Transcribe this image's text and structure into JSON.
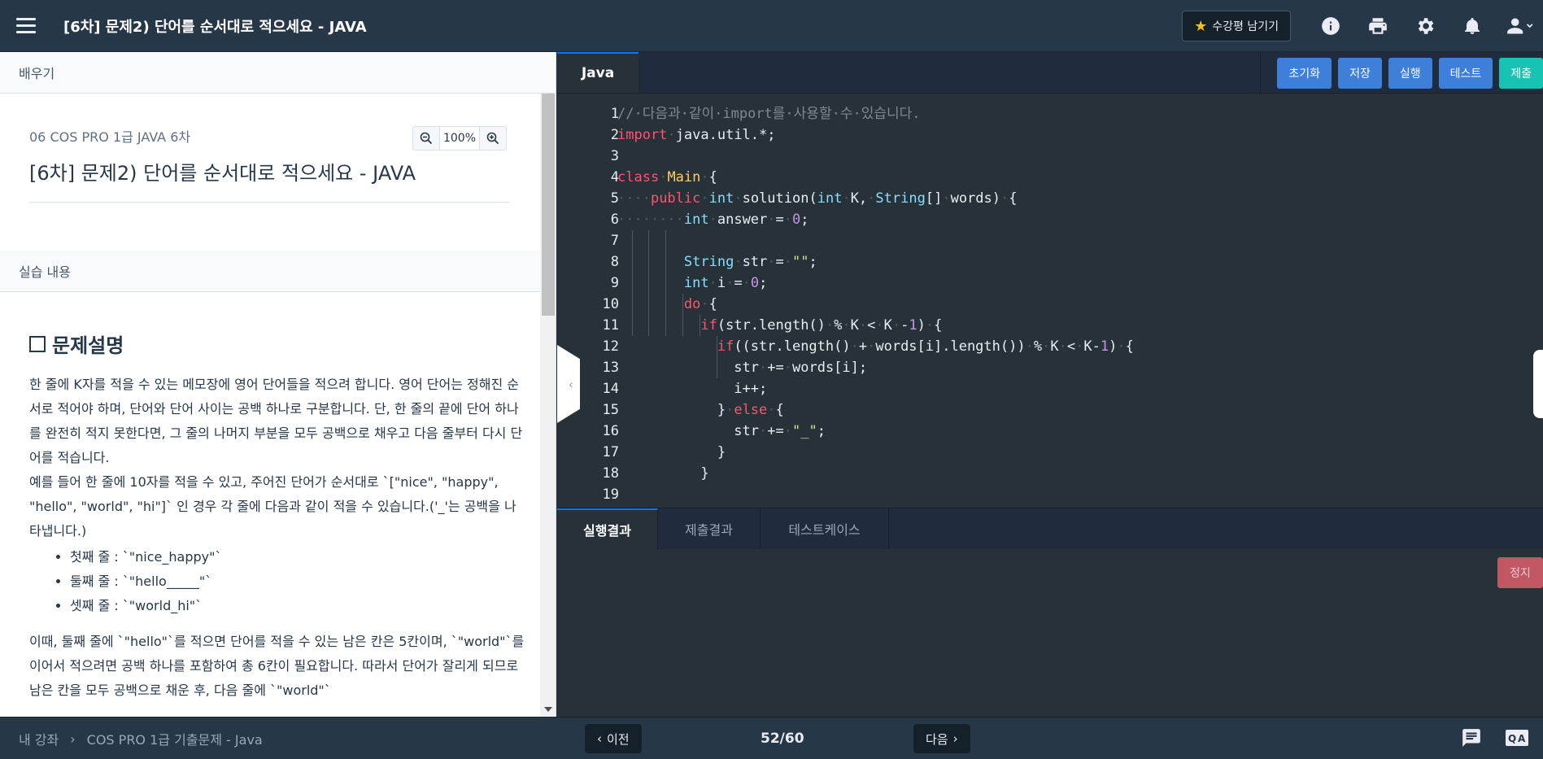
{
  "header": {
    "title": "[6차] 문제2) 단어를 순서대로 적으세요 - JAVA",
    "review_label": "수강평 남기기",
    "icons": [
      "info-icon",
      "print-icon",
      "gear-icon",
      "bell-icon",
      "user-icon"
    ]
  },
  "left": {
    "learn_label": "배우기",
    "course_sub": "06 COS PRO 1급 JAVA 6차",
    "lesson_title": "[6차] 문제2) 단어를 순서대로 적으세요 - JAVA",
    "zoom_level": "100%",
    "practice_label": "실습 내용",
    "problem_heading": "문제설명",
    "paragraph1": "한 줄에 K자를 적을 수 있는 메모장에 영어 단어들을 적으려 합니다. 영어 단어는 정해진 순서로 적어야 하며, 단어와 단어 사이는 공백 하나로 구분합니다. 단, 한 줄의 끝에 단어 하나를 완전히 적지 못한다면, 그 줄의 나머지 부분을 모두 공백으로 채우고 다음 줄부터 다시 단어를 적습니다.",
    "paragraph2": "예를 들어 한 줄에 10자를 적을 수 있고, 주어진 단어가 순서대로 `[\"nice\", \"happy\", \"hello\", \"world\", \"hi\"]` 인 경우 각 줄에 다음과 같이 적을 수 있습니다.('_'는 공백을 나타냅니다.)",
    "bullets": [
      "첫째 줄 : `\"nice_happy\"`",
      "둘째 줄 : `\"hello_____\"`",
      "셋째 줄 : `\"world_hi\"`"
    ],
    "paragraph3": "이때, 둘째 줄에 `\"hello\"`를 적으면 단어를 적을 수 있는 남은 칸은 5칸이며, `\"world\"`를 이어서 적으려면 공백 하나를 포함하여 총 6칸이 필요합니다. 따라서 단어가 잘리게 되므로 남은 칸을 모두 공백으로 채운 후, 다음 줄에 `\"world\"`"
  },
  "editor": {
    "language_tab": "Java",
    "actions": [
      "초기화",
      "저장",
      "실행",
      "테스트",
      "제출"
    ],
    "lines": [
      {
        "n": "1",
        "tokens": [
          [
            "cm",
            "//·다음과·같이·import를·사용할·수·있습니다."
          ]
        ]
      },
      {
        "n": "2",
        "tokens": [
          [
            "kw",
            "import"
          ],
          [
            "dim",
            "·"
          ],
          [
            "",
            "java.util.*;"
          ]
        ]
      },
      {
        "n": "3",
        "tokens": []
      },
      {
        "n": "4",
        "tokens": [
          [
            "kw",
            "class"
          ],
          [
            "dim",
            "·"
          ],
          [
            "cl",
            "Main"
          ],
          [
            "dim",
            "·"
          ],
          [
            "",
            "{"
          ]
        ]
      },
      {
        "n": "5",
        "tokens": [
          [
            "dim",
            "····"
          ],
          [
            "kw",
            "public"
          ],
          [
            "dim",
            "·"
          ],
          [
            "ty",
            "int"
          ],
          [
            "dim",
            "·"
          ],
          [
            "",
            "solution("
          ],
          [
            "ty",
            "int"
          ],
          [
            "dim",
            "·"
          ],
          [
            "",
            "K,"
          ],
          [
            "dim",
            "·"
          ],
          [
            "ty",
            "String"
          ],
          [
            "",
            "[]"
          ],
          [
            "dim",
            "·"
          ],
          [
            "",
            "words)"
          ],
          [
            "dim",
            "·"
          ],
          [
            "",
            "{"
          ]
        ]
      },
      {
        "n": "6",
        "tokens": [
          [
            "dim",
            "········"
          ],
          [
            "ty",
            "int"
          ],
          [
            "dim",
            "·"
          ],
          [
            "",
            "answer"
          ],
          [
            "dim",
            "·"
          ],
          [
            "",
            "="
          ],
          [
            "dim",
            "·"
          ],
          [
            "num",
            "0"
          ],
          [
            "",
            ";"
          ]
        ]
      },
      {
        "n": "7",
        "tokens": []
      },
      {
        "n": "8",
        "tokens": [
          [
            "",
            "        "
          ],
          [
            "ty",
            "String"
          ],
          [
            "dim",
            "·"
          ],
          [
            "",
            "str"
          ],
          [
            "dim",
            "·"
          ],
          [
            "",
            "="
          ],
          [
            "dim",
            "·"
          ],
          [
            "str",
            "\"\""
          ],
          [
            "",
            ";"
          ]
        ]
      },
      {
        "n": "9",
        "tokens": [
          [
            "",
            "        "
          ],
          [
            "ty",
            "int"
          ],
          [
            "dim",
            "·"
          ],
          [
            "",
            "i"
          ],
          [
            "dim",
            "·"
          ],
          [
            "",
            "="
          ],
          [
            "dim",
            "·"
          ],
          [
            "num",
            "0"
          ],
          [
            "",
            ";"
          ]
        ]
      },
      {
        "n": "10",
        "tokens": [
          [
            "",
            "        "
          ],
          [
            "kw",
            "do"
          ],
          [
            "dim",
            "·"
          ],
          [
            "",
            "{"
          ]
        ]
      },
      {
        "n": "11",
        "tokens": [
          [
            "",
            "          "
          ],
          [
            "kw",
            "if"
          ],
          [
            "",
            "(str.length()"
          ],
          [
            "dim",
            "·"
          ],
          [
            "",
            "%"
          ],
          [
            "dim",
            "·"
          ],
          [
            "",
            "K"
          ],
          [
            "dim",
            "·"
          ],
          [
            "",
            "<"
          ],
          [
            "dim",
            "·"
          ],
          [
            "",
            "K"
          ],
          [
            "dim",
            "·"
          ],
          [
            "",
            "-"
          ],
          [
            "num",
            "1"
          ],
          [
            "",
            ")"
          ],
          [
            "dim",
            "·"
          ],
          [
            "",
            "{"
          ]
        ]
      },
      {
        "n": "12",
        "tokens": [
          [
            "",
            "            "
          ],
          [
            "kw",
            "if"
          ],
          [
            "",
            "((str.length()"
          ],
          [
            "dim",
            "·"
          ],
          [
            "",
            "+"
          ],
          [
            "dim",
            "·"
          ],
          [
            "",
            "words[i].length())"
          ],
          [
            "dim",
            "·"
          ],
          [
            "",
            "%"
          ],
          [
            "dim",
            "·"
          ],
          [
            "",
            "K"
          ],
          [
            "dim",
            "·"
          ],
          [
            "",
            "<"
          ],
          [
            "dim",
            "·"
          ],
          [
            "",
            "K-"
          ],
          [
            "num",
            "1"
          ],
          [
            "",
            ")"
          ],
          [
            "dim",
            "·"
          ],
          [
            "",
            "{"
          ]
        ]
      },
      {
        "n": "13",
        "tokens": [
          [
            "",
            "              "
          ],
          [
            "",
            "str"
          ],
          [
            "dim",
            "·"
          ],
          [
            "",
            "+="
          ],
          [
            "dim",
            "·"
          ],
          [
            "",
            "words[i];"
          ]
        ]
      },
      {
        "n": "14",
        "tokens": [
          [
            "",
            "              "
          ],
          [
            "",
            "i++;"
          ]
        ]
      },
      {
        "n": "15",
        "tokens": [
          [
            "",
            "            "
          ],
          [
            "",
            "}"
          ],
          [
            "dim",
            "·"
          ],
          [
            "kw",
            "else"
          ],
          [
            "dim",
            "·"
          ],
          [
            "",
            "{"
          ]
        ]
      },
      {
        "n": "16",
        "tokens": [
          [
            "",
            "              "
          ],
          [
            "",
            "str"
          ],
          [
            "dim",
            "·"
          ],
          [
            "",
            "+="
          ],
          [
            "dim",
            "·"
          ],
          [
            "str",
            "\"_\""
          ],
          [
            "",
            ";"
          ]
        ]
      },
      {
        "n": "17",
        "tokens": [
          [
            "",
            "            "
          ],
          [
            "",
            "}"
          ]
        ]
      },
      {
        "n": "18",
        "tokens": [
          [
            "",
            "          "
          ],
          [
            "",
            "}"
          ]
        ]
      },
      {
        "n": "19",
        "tokens": []
      }
    ]
  },
  "results": {
    "tabs": [
      "실행결과",
      "제출결과",
      "테스트케이스"
    ],
    "stop_label": "정지"
  },
  "footer": {
    "breadcrumb_root": "내 강좌",
    "breadcrumb_sep": "›",
    "breadcrumb_course": "COS PRO 1급 기출문제 - Java",
    "prev_label": "이전",
    "next_label": "다음",
    "page": "52/60",
    "icons": [
      "chat-icon",
      "qna-icon"
    ]
  },
  "colors": {
    "header_bg": "#263747",
    "editor_bg": "#263238",
    "accent_blue": "#3d7fd9",
    "submit_teal": "#17c3b2",
    "stop_red": "#c25764"
  }
}
